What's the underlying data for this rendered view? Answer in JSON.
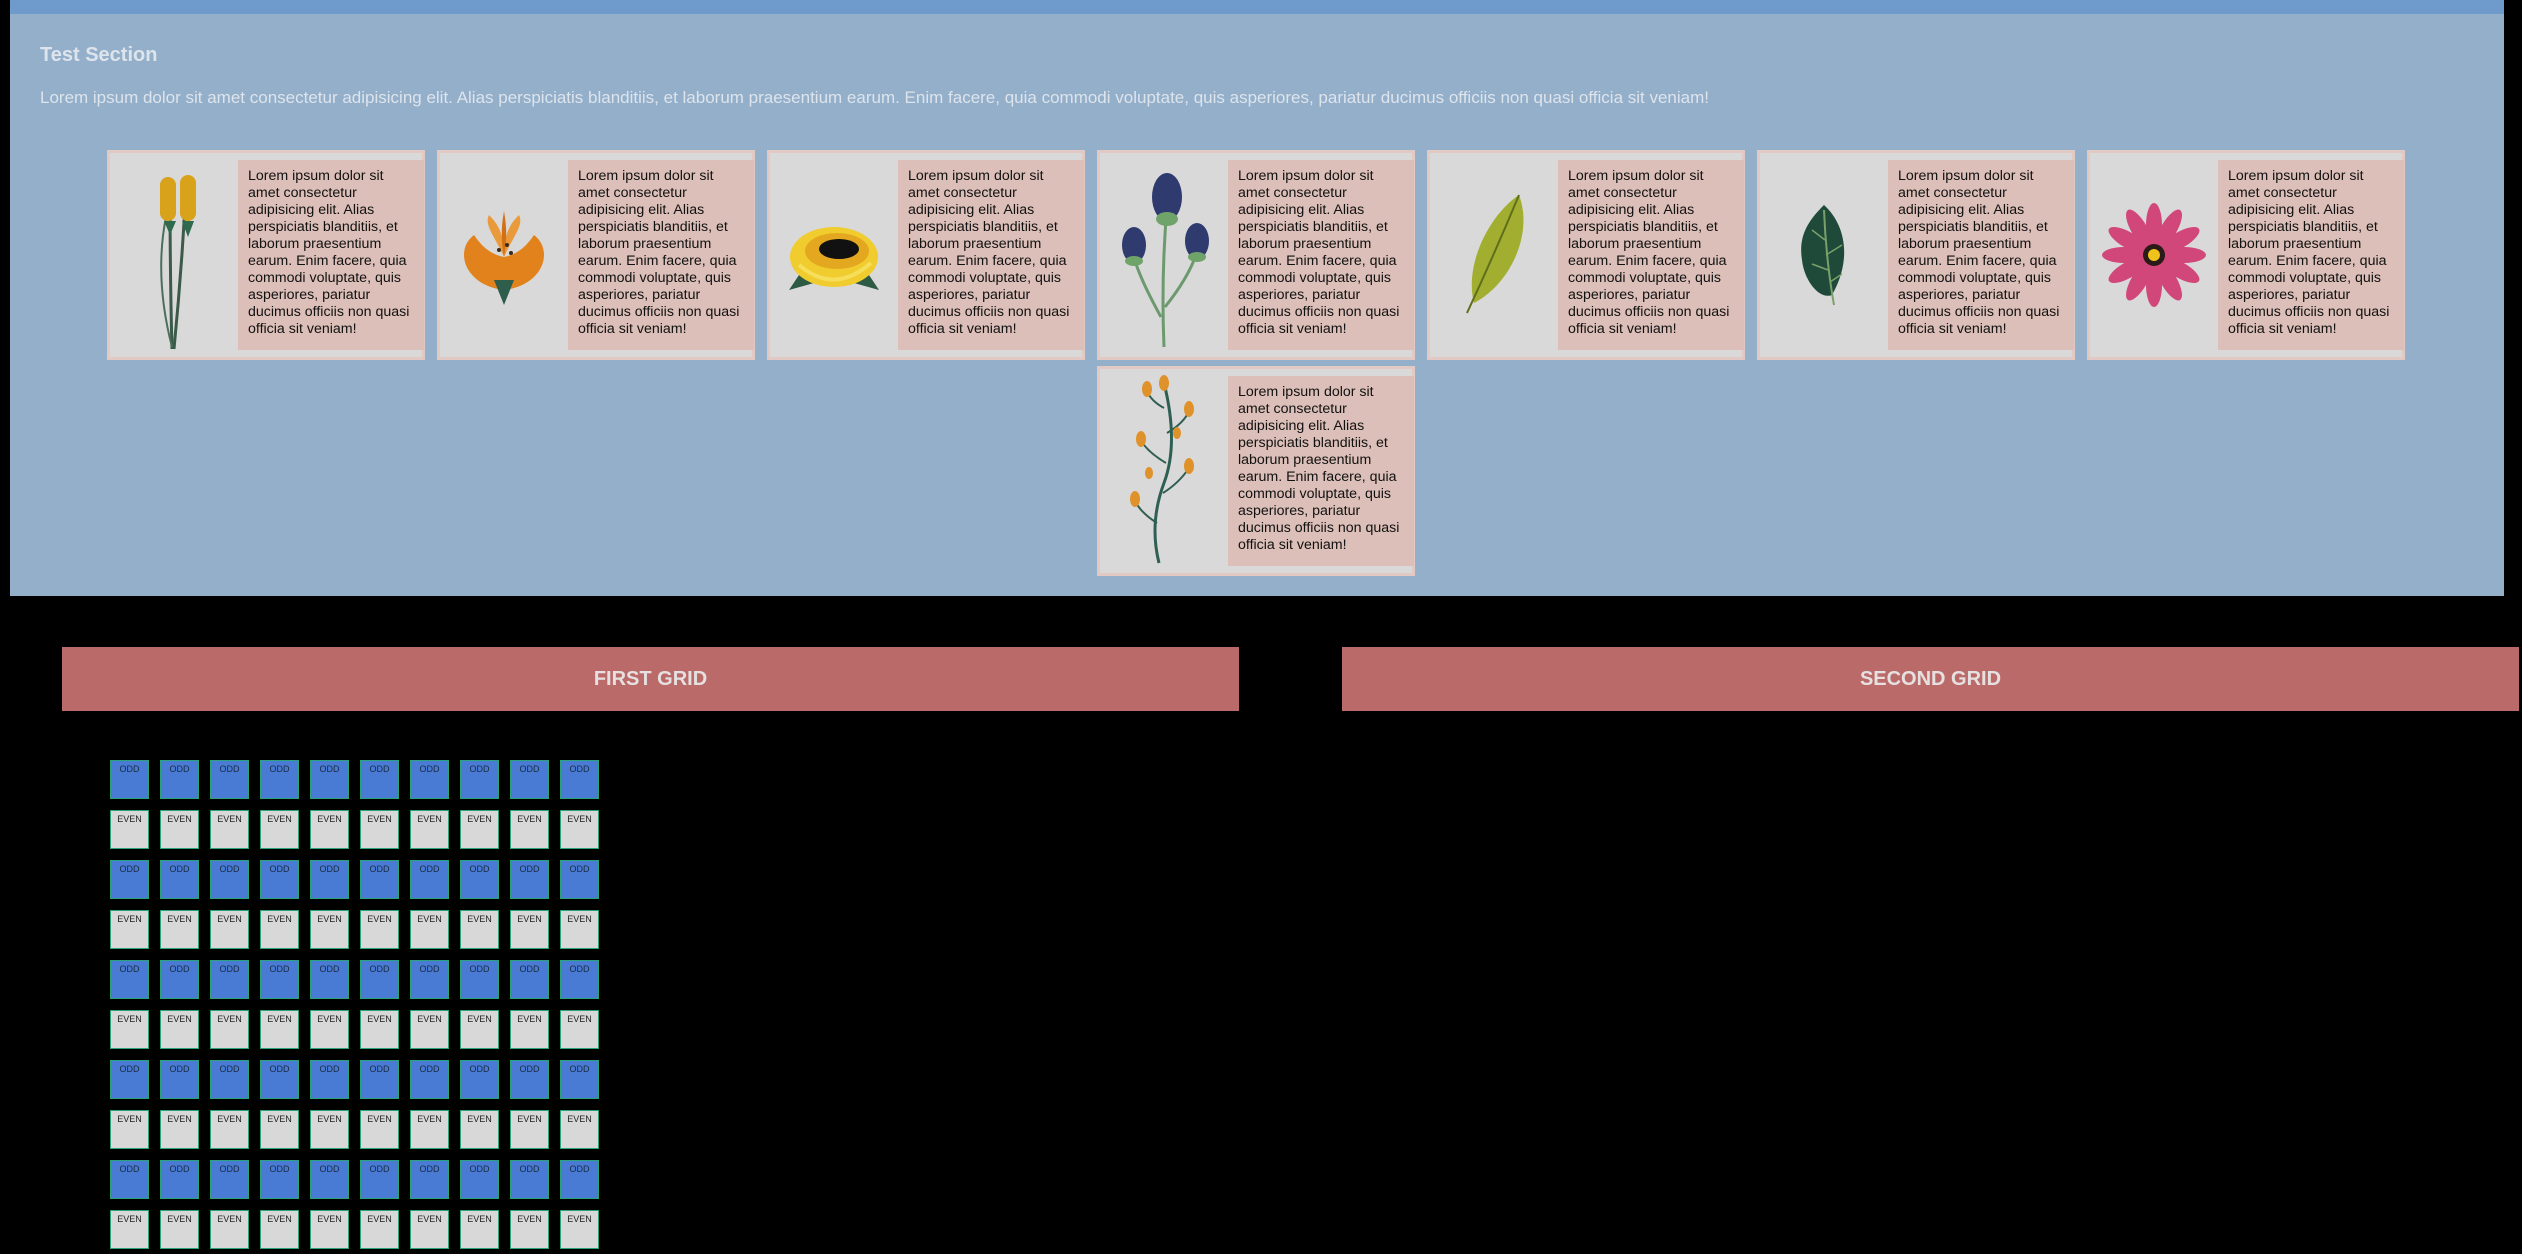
{
  "section": {
    "title": "Test Section",
    "description": "Lorem ipsum dolor sit amet consectetur adipisicing elit. Alias perspiciatis blanditiis, et laborum praesentium earum. Enim facere, quia commodi voluptate, quis asperiores, pariatur ducimus officiis non quasi officia sit veniam!"
  },
  "cards": [
    {
      "illustration": "cattail-illustration",
      "text": "Lorem ipsum dolor sit amet consectetur adipisicing elit. Alias perspiciatis blanditiis, et laborum praesentium earum. Enim facere, quia commodi voluptate, quis asperiores, pariatur ducimus officiis non quasi officia sit veniam!"
    },
    {
      "illustration": "orange-flower-illustration",
      "text": "Lorem ipsum dolor sit amet consectetur adipisicing elit. Alias perspiciatis blanditiis, et laborum praesentium earum. Enim facere, quia commodi voluptate, quis asperiores, pariatur ducimus officiis non quasi officia sit veniam!"
    },
    {
      "illustration": "yellow-rose-illustration",
      "text": "Lorem ipsum dolor sit amet consectetur adipisicing elit. Alias perspiciatis blanditiis, et laborum praesentium earum. Enim facere, quia commodi voluptate, quis asperiores, pariatur ducimus officiis non quasi officia sit veniam!"
    },
    {
      "illustration": "thistle-illustration",
      "text": "Lorem ipsum dolor sit amet consectetur adipisicing elit. Alias perspiciatis blanditiis, et laborum praesentium earum. Enim facere, quia commodi voluptate, quis asperiores, pariatur ducimus officiis non quasi officia sit veniam!"
    },
    {
      "illustration": "green-leaf-illustration",
      "text": "Lorem ipsum dolor sit amet consectetur adipisicing elit. Alias perspiciatis blanditiis, et laborum praesentium earum. Enim facere, quia commodi voluptate, quis asperiores, pariatur ducimus officiis non quasi officia sit veniam!"
    },
    {
      "illustration": "dark-leaf-illustration",
      "text": "Lorem ipsum dolor sit amet consectetur adipisicing elit. Alias perspiciatis blanditiis, et laborum praesentium earum. Enim facere, quia commodi voluptate, quis asperiores, pariatur ducimus officiis non quasi officia sit veniam!"
    },
    {
      "illustration": "pink-daisy-illustration",
      "text": "Lorem ipsum dolor sit amet consectetur adipisicing elit. Alias perspiciatis blanditiis, et laborum praesentium earum. Enim facere, quia commodi voluptate, quis asperiores, pariatur ducimus officiis non quasi officia sit veniam!"
    },
    {
      "illustration": "orange-sprig-illustration",
      "text": "Lorem ipsum dolor sit amet consectetur adipisicing elit. Alias perspiciatis blanditiis, et laborum praesentium earum. Enim facere, quia commodi voluptate, quis asperiores, pariatur ducimus officiis non quasi officia sit veniam!"
    }
  ],
  "grids": {
    "first_title": "FIRST GRID",
    "second_title": "SECOND GRID",
    "odd_label": "ODD",
    "even_label": "EVEN",
    "rows": 10,
    "columns": 10
  },
  "colors": {
    "section_background": "#93afca",
    "header_bar": "#6f9bcc",
    "grid_header": "#bb6a6a",
    "odd_cell": "#4a7bd4",
    "even_cell": "#d8d8d8"
  }
}
